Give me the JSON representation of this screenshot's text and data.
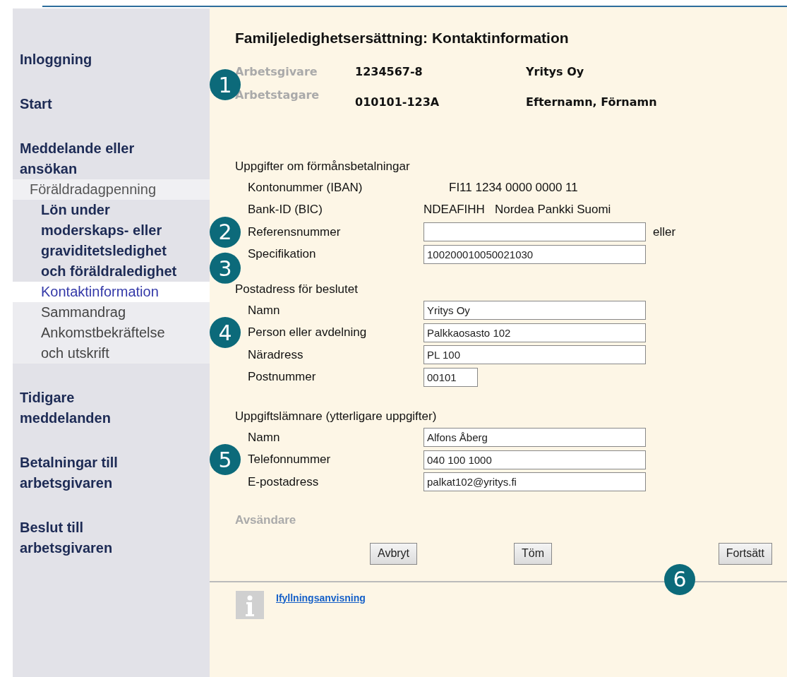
{
  "sidebar": {
    "items": [
      {
        "label": "Inloggning",
        "selected": false
      },
      {
        "label": "Start",
        "selected": false
      },
      {
        "label": "Meddelande eller ansökan",
        "selected": false,
        "children": [
          {
            "label": "Föräldradagpenning",
            "selected": false,
            "children": [
              {
                "label": "Lön under moderskaps- eller graviditetsledighet och föräldraledighet",
                "selected": false,
                "children": [
                  {
                    "label": "Kontaktinformation",
                    "selected": true
                  },
                  {
                    "label": "Sammandrag",
                    "selected": false
                  },
                  {
                    "label": "Ankomstbekräftelse och utskrift",
                    "selected": false
                  }
                ]
              }
            ]
          }
        ]
      },
      {
        "label": "Tidigare meddelanden",
        "selected": false
      },
      {
        "label": "Betalningar till arbetsgivaren",
        "selected": false
      },
      {
        "label": "Beslut till arbetsgivaren",
        "selected": false
      }
    ]
  },
  "page_title": "Familjeledighetsersättning: Kontaktinformation",
  "parties": {
    "callout": "1",
    "rows": [
      {
        "label": "Arbetsgivare",
        "id": "1234567-8",
        "name": "Yritys Oy"
      },
      {
        "label": "Arbetstagare",
        "id": "010101-123A",
        "name": "Efternamn, Förnamn"
      }
    ]
  },
  "sections": [
    {
      "heading": "Uppgifter om förmånsbetalningar",
      "rows": [
        {
          "kind": "text",
          "label": "Kontonummer (IBAN)",
          "value": "FI11 1234 0000 0000 11"
        },
        {
          "kind": "text",
          "label": "Bank-ID (BIC)",
          "value": "NDEAFIHH",
          "extra": "Nordea Pankki Suomi"
        },
        {
          "kind": "field",
          "label": "Referensnummer",
          "value": "",
          "suffix": "eller",
          "callout": "2"
        },
        {
          "kind": "field",
          "label": "Specifikation",
          "value": "100200010050021030",
          "callout": "3"
        }
      ]
    },
    {
      "heading": "Postadress för beslutet",
      "rows": [
        {
          "kind": "field",
          "label": "Namn",
          "value": "Yritys Oy"
        },
        {
          "kind": "field",
          "label": "Person eller avdelning",
          "value": "Palkkaosasto 102",
          "callout": "4"
        },
        {
          "kind": "field",
          "label": "Näradress",
          "value": "PL 100"
        },
        {
          "kind": "short_field",
          "label": "Postnummer",
          "value": "00101"
        }
      ]
    },
    {
      "heading": "Uppgiftslämnare (ytterligare uppgifter)",
      "rows": [
        {
          "kind": "field",
          "label": "Namn",
          "value": "Alfons Åberg"
        },
        {
          "kind": "field",
          "label": "Telefonnummer",
          "value": "040 100 1000",
          "callout": "5"
        },
        {
          "kind": "field",
          "label": "E-postadress",
          "value": "palkat102@yritys.fi"
        }
      ]
    }
  ],
  "sender_heading": "Avsändare",
  "buttons": [
    "Avbryt",
    "Töm",
    "Fortsätt"
  ],
  "buttons_callout": "6",
  "help_link": "Ifyllningsanvisning"
}
